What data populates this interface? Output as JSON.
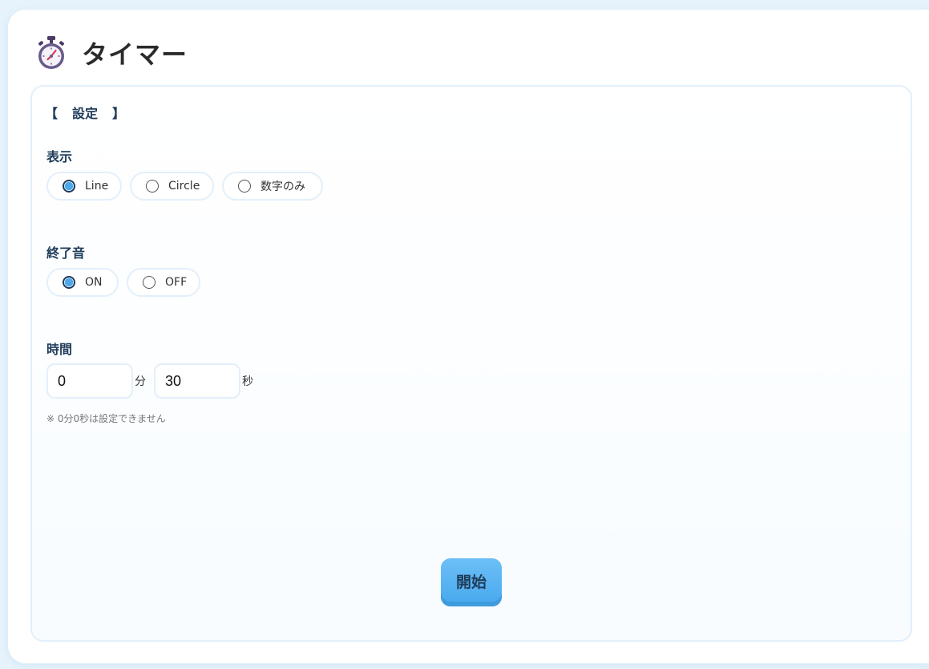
{
  "app": {
    "title": "タイマー",
    "icon": "stopwatch-icon"
  },
  "settings": {
    "bracket_open": "【",
    "title": "設定",
    "bracket_close": "】"
  },
  "display": {
    "label": "表示",
    "options": [
      "Line",
      "Circle",
      "数字のみ"
    ],
    "selected": "Line"
  },
  "end_sound": {
    "label": "終了音",
    "options": [
      "ON",
      "OFF"
    ],
    "selected": "ON"
  },
  "time": {
    "label": "時間",
    "minutes_value": "0",
    "minutes_unit": "分",
    "seconds_value": "30",
    "seconds_unit": "秒",
    "note": "※ 0分0秒は設定できません"
  },
  "start_button": {
    "label": "開始"
  },
  "colors": {
    "accent": "#4aa8ec",
    "heading": "#1f3b5a",
    "border": "#e3effa"
  }
}
